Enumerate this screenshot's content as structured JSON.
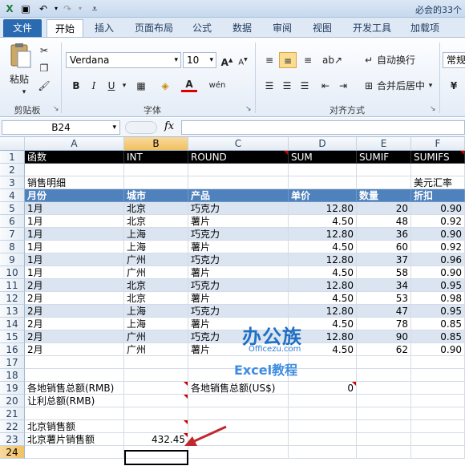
{
  "window": {
    "title": "必会的33个"
  },
  "quick_access": {
    "save_icon": "save-icon",
    "undo_icon": "undo-icon",
    "redo_icon": "redo-icon"
  },
  "tabs": [
    "文件",
    "开始",
    "插入",
    "页面布局",
    "公式",
    "数据",
    "审阅",
    "视图",
    "开发工具",
    "加载项"
  ],
  "ribbon": {
    "paste_label": "粘贴",
    "clipboard_label": "剪贴板",
    "font_name": "Verdana",
    "font_size": "10",
    "font_group_label": "字体",
    "bold": "B",
    "italic": "I",
    "underline": "U",
    "font_color": "A",
    "wen": "wén",
    "grow_font": "A",
    "shrink_font": "A",
    "wrap_text": "自动换行",
    "merge_center": "合并后居中",
    "align_group_label": "对齐方式",
    "number_format": "常规"
  },
  "formula_bar": {
    "name_box": "B24",
    "fx": "fx",
    "content": ""
  },
  "columns": [
    "A",
    "B",
    "C",
    "D",
    "E",
    "F"
  ],
  "rows": [
    "1",
    "2",
    "3",
    "4",
    "5",
    "6",
    "7",
    "8",
    "9",
    "10",
    "11",
    "12",
    "13",
    "14",
    "15",
    "16",
    "17",
    "18",
    "19",
    "20",
    "21",
    "22",
    "23",
    "24"
  ],
  "row1": [
    "函数",
    "INT",
    "ROUND",
    "SUM",
    "SUMIF",
    "SUMIFS"
  ],
  "row3": {
    "a": "销售明细",
    "f": "美元汇率"
  },
  "header": [
    "月份",
    "城市",
    "产品",
    "单价",
    "数量",
    "折扣"
  ],
  "data": [
    [
      "1月",
      "北京",
      "巧克力",
      "12.80",
      "20",
      "0.90"
    ],
    [
      "1月",
      "北京",
      "薯片",
      "4.50",
      "48",
      "0.92"
    ],
    [
      "1月",
      "上海",
      "巧克力",
      "12.80",
      "36",
      "0.90"
    ],
    [
      "1月",
      "上海",
      "薯片",
      "4.50",
      "60",
      "0.92"
    ],
    [
      "1月",
      "广州",
      "巧克力",
      "12.80",
      "37",
      "0.96"
    ],
    [
      "1月",
      "广州",
      "薯片",
      "4.50",
      "58",
      "0.90"
    ],
    [
      "2月",
      "北京",
      "巧克力",
      "12.80",
      "34",
      "0.95"
    ],
    [
      "2月",
      "北京",
      "薯片",
      "4.50",
      "53",
      "0.98"
    ],
    [
      "2月",
      "上海",
      "巧克力",
      "12.80",
      "47",
      "0.95"
    ],
    [
      "2月",
      "上海",
      "薯片",
      "4.50",
      "78",
      "0.85"
    ],
    [
      "2月",
      "广州",
      "巧克力",
      "12.80",
      "90",
      "0.85"
    ],
    [
      "2月",
      "广州",
      "薯片",
      "4.50",
      "62",
      "0.90"
    ]
  ],
  "row19": {
    "a": "各地销售总额(RMB)",
    "c": "各地销售总额(US$)",
    "d": "0"
  },
  "row20": {
    "a": "让利总额(RMB)"
  },
  "row22": {
    "a": "北京销售额"
  },
  "row23": {
    "a": "北京薯片销售额",
    "b": "432.45"
  },
  "watermark": {
    "line1": "办公族",
    "line2": "Officezu.com",
    "line3": "Excel教程"
  },
  "colors": {
    "header_blue": "#4f81bd",
    "band": "#dbe5f1",
    "file_tab": "#2a6ab1",
    "arrow": "#c0282d"
  }
}
